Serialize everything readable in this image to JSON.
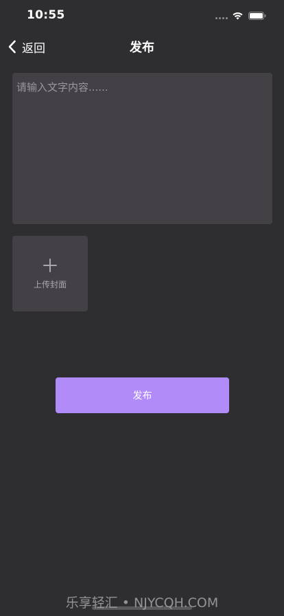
{
  "status_bar": {
    "time": "10:55"
  },
  "nav": {
    "back_label": "返回",
    "title": "发布"
  },
  "editor": {
    "placeholder": "请输入文字内容......",
    "value": ""
  },
  "upload": {
    "label": "上传封面"
  },
  "actions": {
    "publish_label": "发布"
  },
  "watermark": {
    "text": "乐享轻汇 • NJYCQH.COM"
  },
  "colors": {
    "background": "#2e2d2f",
    "input_background": "#434146",
    "accent": "#b18cf9",
    "placeholder": "#9a989d"
  },
  "icons": {
    "back": "chevron-left-icon",
    "wifi": "wifi-icon",
    "battery": "battery-icon",
    "signal": "signal-dots-icon",
    "add": "plus-icon"
  }
}
